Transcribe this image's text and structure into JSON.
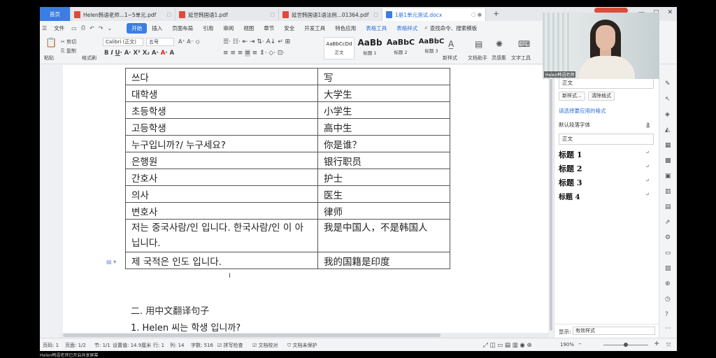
{
  "tabs": [
    {
      "label": "首页",
      "type": "home"
    },
    {
      "label": "Helen韩语老师...1~5单元.pdf",
      "type": "pdf"
    },
    {
      "label": "延世韩国语1.pdf",
      "type": "pdf"
    },
    {
      "label": "延世韩国语1语法例...01364.pdf",
      "type": "pdf"
    },
    {
      "label": "1册1单元测试.docx",
      "type": "doc",
      "active": true
    }
  ],
  "menu": {
    "file": "文件",
    "items": [
      "开始",
      "插入",
      "页面布局",
      "引用",
      "审阅",
      "视图",
      "章节",
      "安全",
      "开发工具",
      "特色应用",
      "表格工具",
      "表格样式"
    ],
    "search": "查找命令、搜索模板"
  },
  "toolbar": {
    "paste": "粘贴",
    "cut": "剪切",
    "copy": "复制",
    "format_painter": "格式刷",
    "font_name": "Calibri (正文)",
    "font_size": "五号",
    "styles": [
      {
        "preview": "AaBbCcDd",
        "name": "正文"
      },
      {
        "preview": "AaBb",
        "name": "标题 1"
      },
      {
        "preview": "AaBbC",
        "name": "标题 2"
      },
      {
        "preview": "AaBbC",
        "name": "标题 3"
      }
    ],
    "new_style": "新样式",
    "doc_assistant": "文档助手",
    "inspiration": "灵感集",
    "text_tools": "文字工具"
  },
  "vocab_table": [
    {
      "ko": "쓰다",
      "zh": "写"
    },
    {
      "ko": "대학생",
      "zh": "大学生"
    },
    {
      "ko": "초등학생",
      "zh": "小学生"
    },
    {
      "ko": "고등학생",
      "zh": "高中生"
    },
    {
      "ko": "누구입니까?/ 누구세요?",
      "zh": "你是谁？"
    },
    {
      "ko": "은행원",
      "zh": "银行职员"
    },
    {
      "ko": "간호사",
      "zh": "护士"
    },
    {
      "ko": "의사",
      "zh": "医生"
    },
    {
      "ko": "변호사",
      "zh": "律师"
    },
    {
      "ko": "저는 중국사람/인 입니다. 한국사람/인 이 아닙니다.",
      "zh": "我是中国人，不是韩国人"
    },
    {
      "ko": "제 국적은 인도 입니다.",
      "zh": "我的国籍是印度"
    }
  ],
  "section2_title": "二. 用中文翻译句子",
  "question1": "1. Helen 씨는 학생 입니까?",
  "side_panel": {
    "current_style": "正文",
    "new_style_btn": "新样式...",
    "clear_format_btn": "清除格式",
    "apply_label": "请选择要应用的格式",
    "default_font": "默认段落字体",
    "body_style": "正文",
    "headings": [
      "标题 1",
      "标题 2",
      "标题 3",
      "标题 4"
    ],
    "show_label": "显示:",
    "show_value": "有效样式"
  },
  "status": {
    "page_no": "页码: 1",
    "pages": "页面: 1/2",
    "section": "节: 1/1",
    "setting": "设置值: 14.9厘米",
    "row": "行: 1",
    "col": "列: 14",
    "words": "字数: 516",
    "spell": "拼写检查",
    "proof": "文档校对",
    "unprotected": "文档未保护",
    "zoom": "190%",
    "zoom_fraction": 0.5
  },
  "webcam_label": "Helen韩语老师",
  "bottom_label": "Helen韩语老师已开启共享屏幕"
}
